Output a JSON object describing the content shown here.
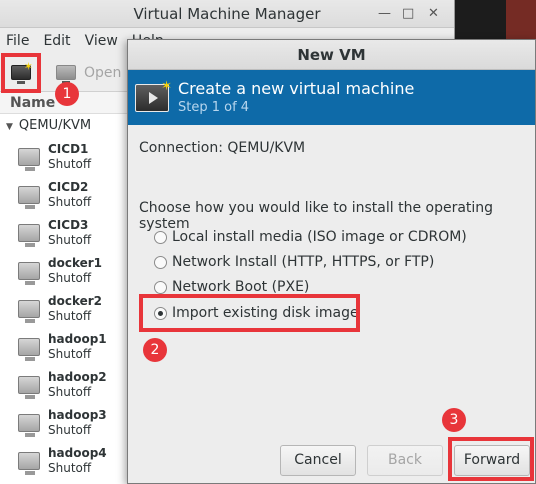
{
  "vmm": {
    "title": "Virtual Machine Manager",
    "menu": [
      "File",
      "Edit",
      "View",
      "Help"
    ],
    "toolbar": {
      "open_label": "Open"
    },
    "list_header": "Name",
    "group": "QEMU/KVM",
    "vms": [
      {
        "name": "CICD1",
        "state": "Shutoff"
      },
      {
        "name": "CICD2",
        "state": "Shutoff"
      },
      {
        "name": "CICD3",
        "state": "Shutoff"
      },
      {
        "name": "docker1",
        "state": "Shutoff"
      },
      {
        "name": "docker2",
        "state": "Shutoff"
      },
      {
        "name": "hadoop1",
        "state": "Shutoff"
      },
      {
        "name": "hadoop2",
        "state": "Shutoff"
      },
      {
        "name": "hadoop3",
        "state": "Shutoff"
      },
      {
        "name": "hadoop4",
        "state": "Shutoff"
      }
    ]
  },
  "dialog": {
    "title": "New VM",
    "banner_title": "Create a new virtual machine",
    "banner_step": "Step 1 of 4",
    "connection": "Connection: QEMU/KVM",
    "prompt": "Choose how you would like to install the operating system",
    "options": [
      {
        "label": "Local install media (ISO image or CDROM)",
        "selected": false
      },
      {
        "label": "Network Install (HTTP, HTTPS, or FTP)",
        "selected": false
      },
      {
        "label": "Network Boot (PXE)",
        "selected": false
      },
      {
        "label": "Import existing disk image",
        "selected": true
      }
    ],
    "buttons": {
      "cancel": "Cancel",
      "back": "Back",
      "forward": "Forward"
    }
  },
  "annotations": {
    "step1": "1",
    "step2": "2",
    "step3": "3",
    "color": "#e8353a"
  }
}
